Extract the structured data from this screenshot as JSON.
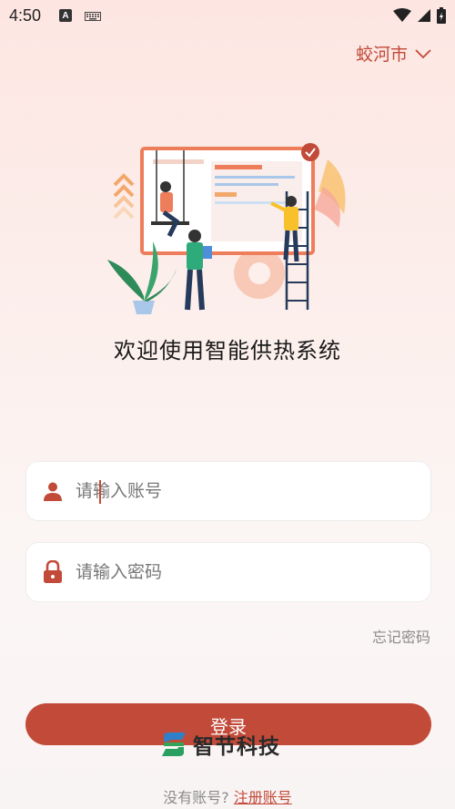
{
  "status_bar": {
    "time": "4:50",
    "icons": [
      "a-letter-icon",
      "keyboard-icon",
      "wifi-icon",
      "signal-icon",
      "battery-icon"
    ]
  },
  "location": {
    "city": "蛟河市",
    "dropdown_icon": "chevron-down-icon"
  },
  "welcome_text": "欢迎使用智能供热系统",
  "login_form": {
    "username_placeholder": "请输入账号",
    "username_value": "",
    "password_placeholder": "请输入密码",
    "password_value": "",
    "forgot_password": "忘记密码",
    "login_button": "登录"
  },
  "brand": {
    "name": "智节科技",
    "logo_icon": "brand-logo-icon"
  },
  "register": {
    "prompt": "没有账号?",
    "link": "注册账号"
  },
  "colors": {
    "accent": "#c24a38",
    "background_top": "#fde6e2",
    "background_bottom": "#f9f4f4"
  }
}
